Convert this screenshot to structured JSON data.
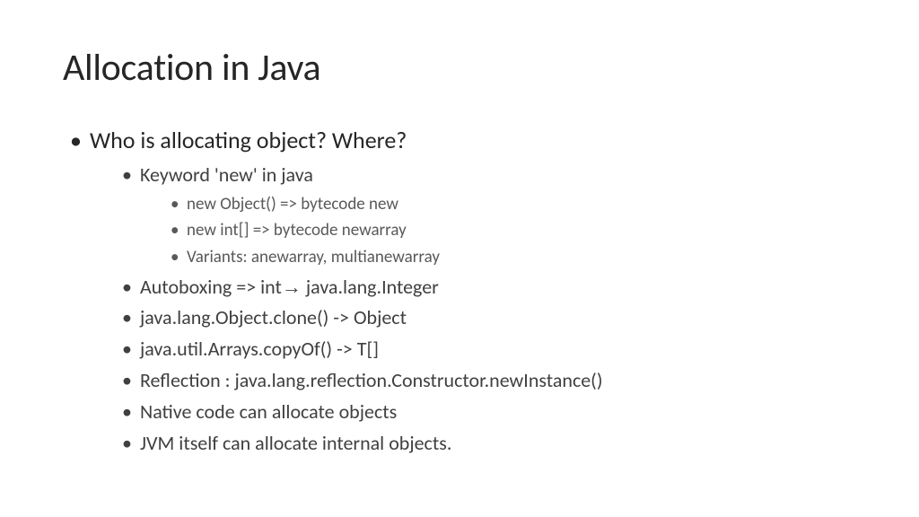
{
  "title": "Allocation in Java",
  "lvl1": [
    {
      "text": "Who is allocating object? Where?"
    }
  ],
  "lvl2": [
    {
      "text": "Keyword 'new' in java"
    },
    {
      "text_pre": "Autoboxing => int",
      "arrow": "→",
      "text_post": " java.lang.Integer"
    },
    {
      "text": "java.lang.Object.clone() -> Object"
    },
    {
      "text": "java.util.Arrays.copyOf() -> T[]"
    },
    {
      "text": "Reflection : java.lang.reflection.Constructor.newInstance()"
    },
    {
      "text": "Native code can allocate objects"
    },
    {
      "text": "JVM itself can allocate internal objects."
    }
  ],
  "lvl3": [
    {
      "text": "new Object() => bytecode new"
    },
    {
      "text": "new int[]        => bytecode newarray"
    },
    {
      "text": "Variants: anewarray, multianewarray"
    }
  ]
}
